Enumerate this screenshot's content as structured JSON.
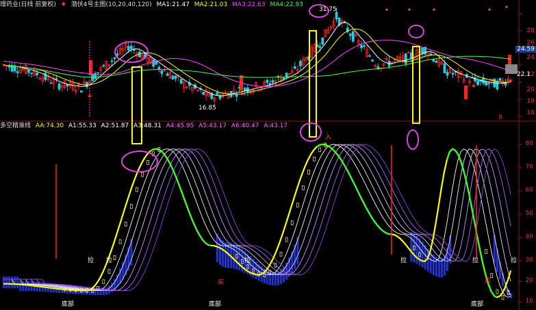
{
  "main_panel": {
    "stock_name": "理药业(日线 前复权)",
    "indicator_name": "潜伏4号主图(10,20,40,120)",
    "ma": [
      {
        "label": "MA1:",
        "value": "21.47",
        "color": "#ffffff"
      },
      {
        "label": "MA2:",
        "value": "21.03",
        "color": "#ffff00"
      },
      {
        "label": "MA3:",
        "value": "22.63",
        "color": "#ff44ff"
      },
      {
        "label": "MA4:",
        "value": "22.93",
        "color": "#44ff44"
      }
    ],
    "high_label": "31.75",
    "low_label": "16.85",
    "current_price": "24.59",
    "price_box": "22.1",
    "price_ticks": [
      "28",
      "26",
      "24",
      "22",
      "20",
      "18",
      "16"
    ],
    "corner_value": "8"
  },
  "sub_panel": {
    "indicator_name": "多空精准线",
    "values": [
      {
        "label": "AA:",
        "value": "74.30",
        "color": "#ffff00"
      },
      {
        "label": "A1:",
        "value": "55.33",
        "color": "#ffffff"
      },
      {
        "label": "A2:",
        "value": "51.87",
        "color": "#ffffff"
      },
      {
        "label": "A3:",
        "value": "48.31",
        "color": "#ffffff"
      },
      {
        "label": "A4:",
        "value": "45.95",
        "color": "#ff66ff"
      },
      {
        "label": "A5:",
        "value": "43.17",
        "color": "#ff66ff"
      },
      {
        "label": "A6:",
        "value": "40.47",
        "color": "#ff66ff"
      },
      {
        "label": "A:",
        "value": "43.17",
        "color": "#ff66ff"
      }
    ],
    "ticks": [
      "80",
      "70",
      "60",
      "50",
      "40",
      "30",
      "20",
      "10"
    ],
    "bottom_labels": [
      "底部",
      "底部",
      "底部"
    ],
    "pull_labels": [
      "拉",
      "拉",
      "拉",
      "拉",
      "拉",
      "拉"
    ],
    "buy_label": "入",
    "buy_labels": [
      "买",
      "买"
    ]
  },
  "colors": {
    "up": "#ff2222",
    "down": "#22ccdd",
    "hi": "#ffff00",
    "circle": "#dd44dd"
  }
}
